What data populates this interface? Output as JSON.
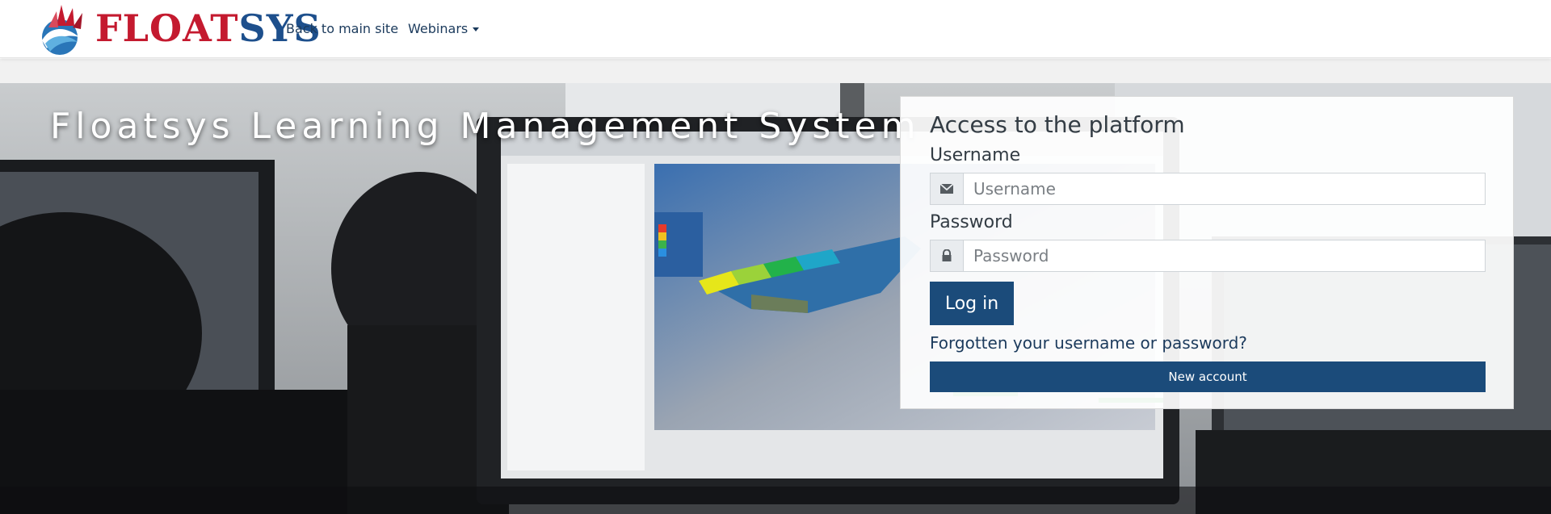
{
  "brand": {
    "logo_text_a": "FLOAT",
    "logo_text_b": "SYS",
    "logo_red": "#c41a2f",
    "logo_blue": "#1d4f8c"
  },
  "nav": {
    "back_to_main": "Back to main site",
    "webinars": "Webinars"
  },
  "hero": {
    "title": "Floatsys Learning Management System"
  },
  "login": {
    "heading": "Access to the platform",
    "username_label": "Username",
    "username_placeholder": "Username",
    "username_value": "",
    "password_label": "Password",
    "password_placeholder": "Password",
    "password_value": "",
    "login_button": "Log in",
    "forgot_link": "Forgotten your username or password?",
    "new_account_button": "New account",
    "accent": "#1b4b7a",
    "username_icon": "envelope-icon",
    "password_icon": "lock-icon"
  }
}
